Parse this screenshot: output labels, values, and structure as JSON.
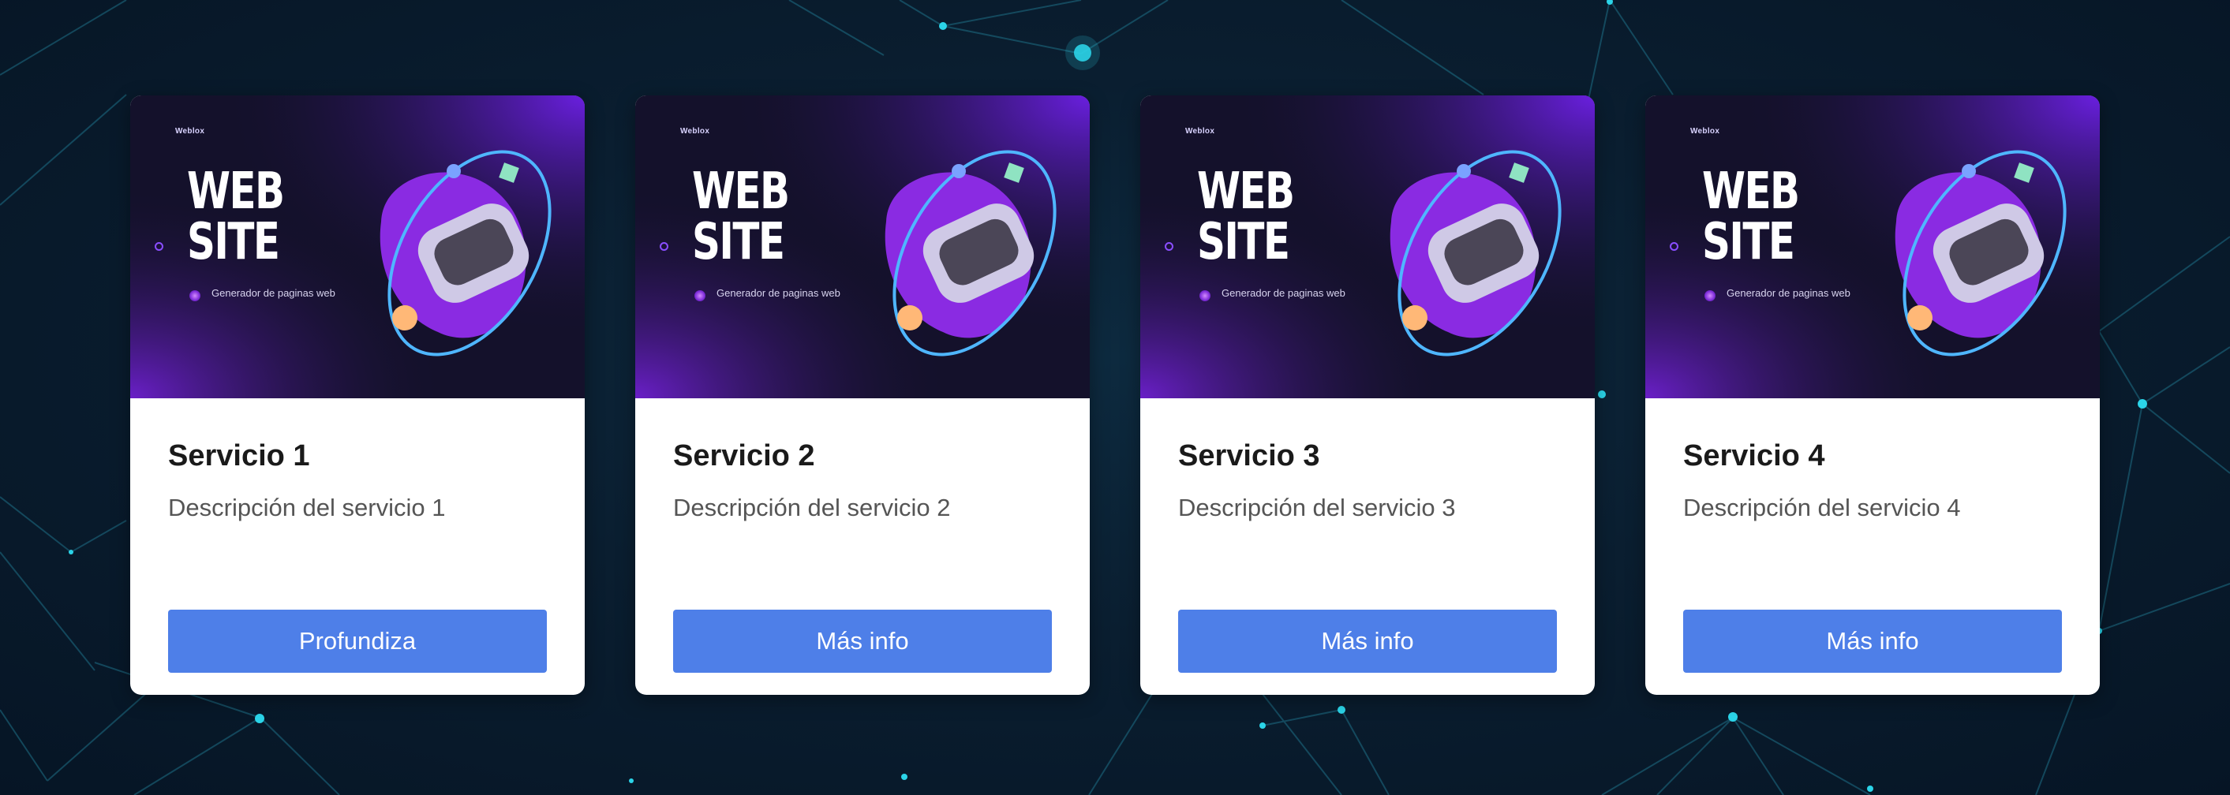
{
  "colors": {
    "background": "#0a1e30",
    "network": "#1e6f86",
    "node": "#2bd4e8",
    "card": "#ffffff",
    "button": "#4e7fe8",
    "image_bg": "#14112b",
    "purple_accent": "#8a2be2"
  },
  "cards": [
    {
      "image": {
        "brand": "Weblox",
        "line1": "WEB",
        "line2": "SITE",
        "tagline": "Generador de paginas web"
      },
      "title": "Servicio 1",
      "description": "Descripción del servicio 1",
      "button": "Profundiza"
    },
    {
      "image": {
        "brand": "Weblox",
        "line1": "WEB",
        "line2": "SITE",
        "tagline": "Generador de paginas web"
      },
      "title": "Servicio 2",
      "description": "Descripción del servicio 2",
      "button": "Más info"
    },
    {
      "image": {
        "brand": "Weblox",
        "line1": "WEB",
        "line2": "SITE",
        "tagline": "Generador de paginas web"
      },
      "title": "Servicio 3",
      "description": "Descripción del servicio 3",
      "button": "Más info"
    },
    {
      "image": {
        "brand": "Weblox",
        "line1": "WEB",
        "line2": "SITE",
        "tagline": "Generador de paginas web"
      },
      "title": "Servicio 4",
      "description": "Descripción del servicio 4",
      "button": "Más info"
    }
  ]
}
